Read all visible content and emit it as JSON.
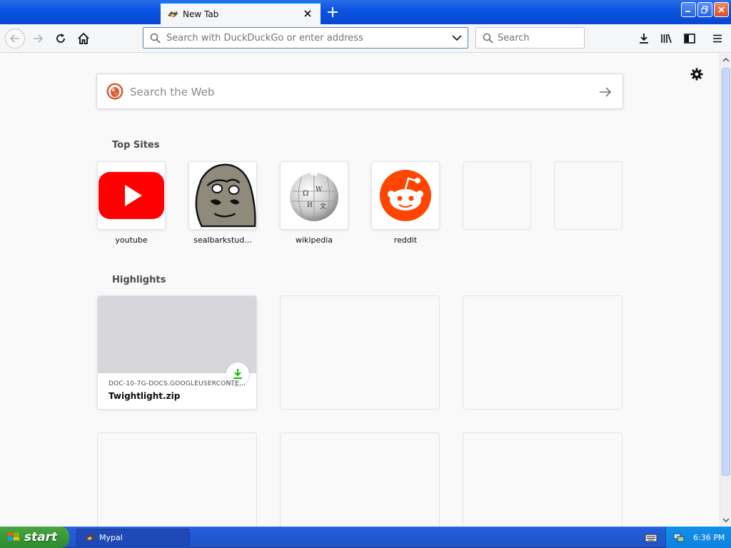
{
  "browser": {
    "tab_title": "New Tab",
    "url_placeholder": "Search with DuckDuckGo or enter address",
    "search_placeholder": "Search"
  },
  "newtab": {
    "web_search_placeholder": "Search the Web",
    "top_sites_title": "Top Sites",
    "highlights_title": "Highlights",
    "top_sites": [
      {
        "label": "youtube",
        "icon": "youtube-logo"
      },
      {
        "label": "sealbarkstud...",
        "icon": "seal-drawing"
      },
      {
        "label": "wikipedia",
        "icon": "wikipedia-globe"
      },
      {
        "label": "reddit",
        "icon": "reddit-alien"
      }
    ],
    "highlight": {
      "host": "DOC-10-7G-DOCS.GOOGLEUSERCONTEN...",
      "filename": "Twightlight.zip",
      "icon": "download-icon"
    }
  },
  "taskbar": {
    "start_label": "start",
    "task_label": "Mypal",
    "clock": "6:36 PM"
  },
  "colors": {
    "accent": "#0a84ff",
    "youtube": "#ff0000",
    "reddit": "#ff4500",
    "download_green": "#12bc00",
    "taskbar_blue": "#245edb",
    "start_green": "#3c9a3a"
  }
}
